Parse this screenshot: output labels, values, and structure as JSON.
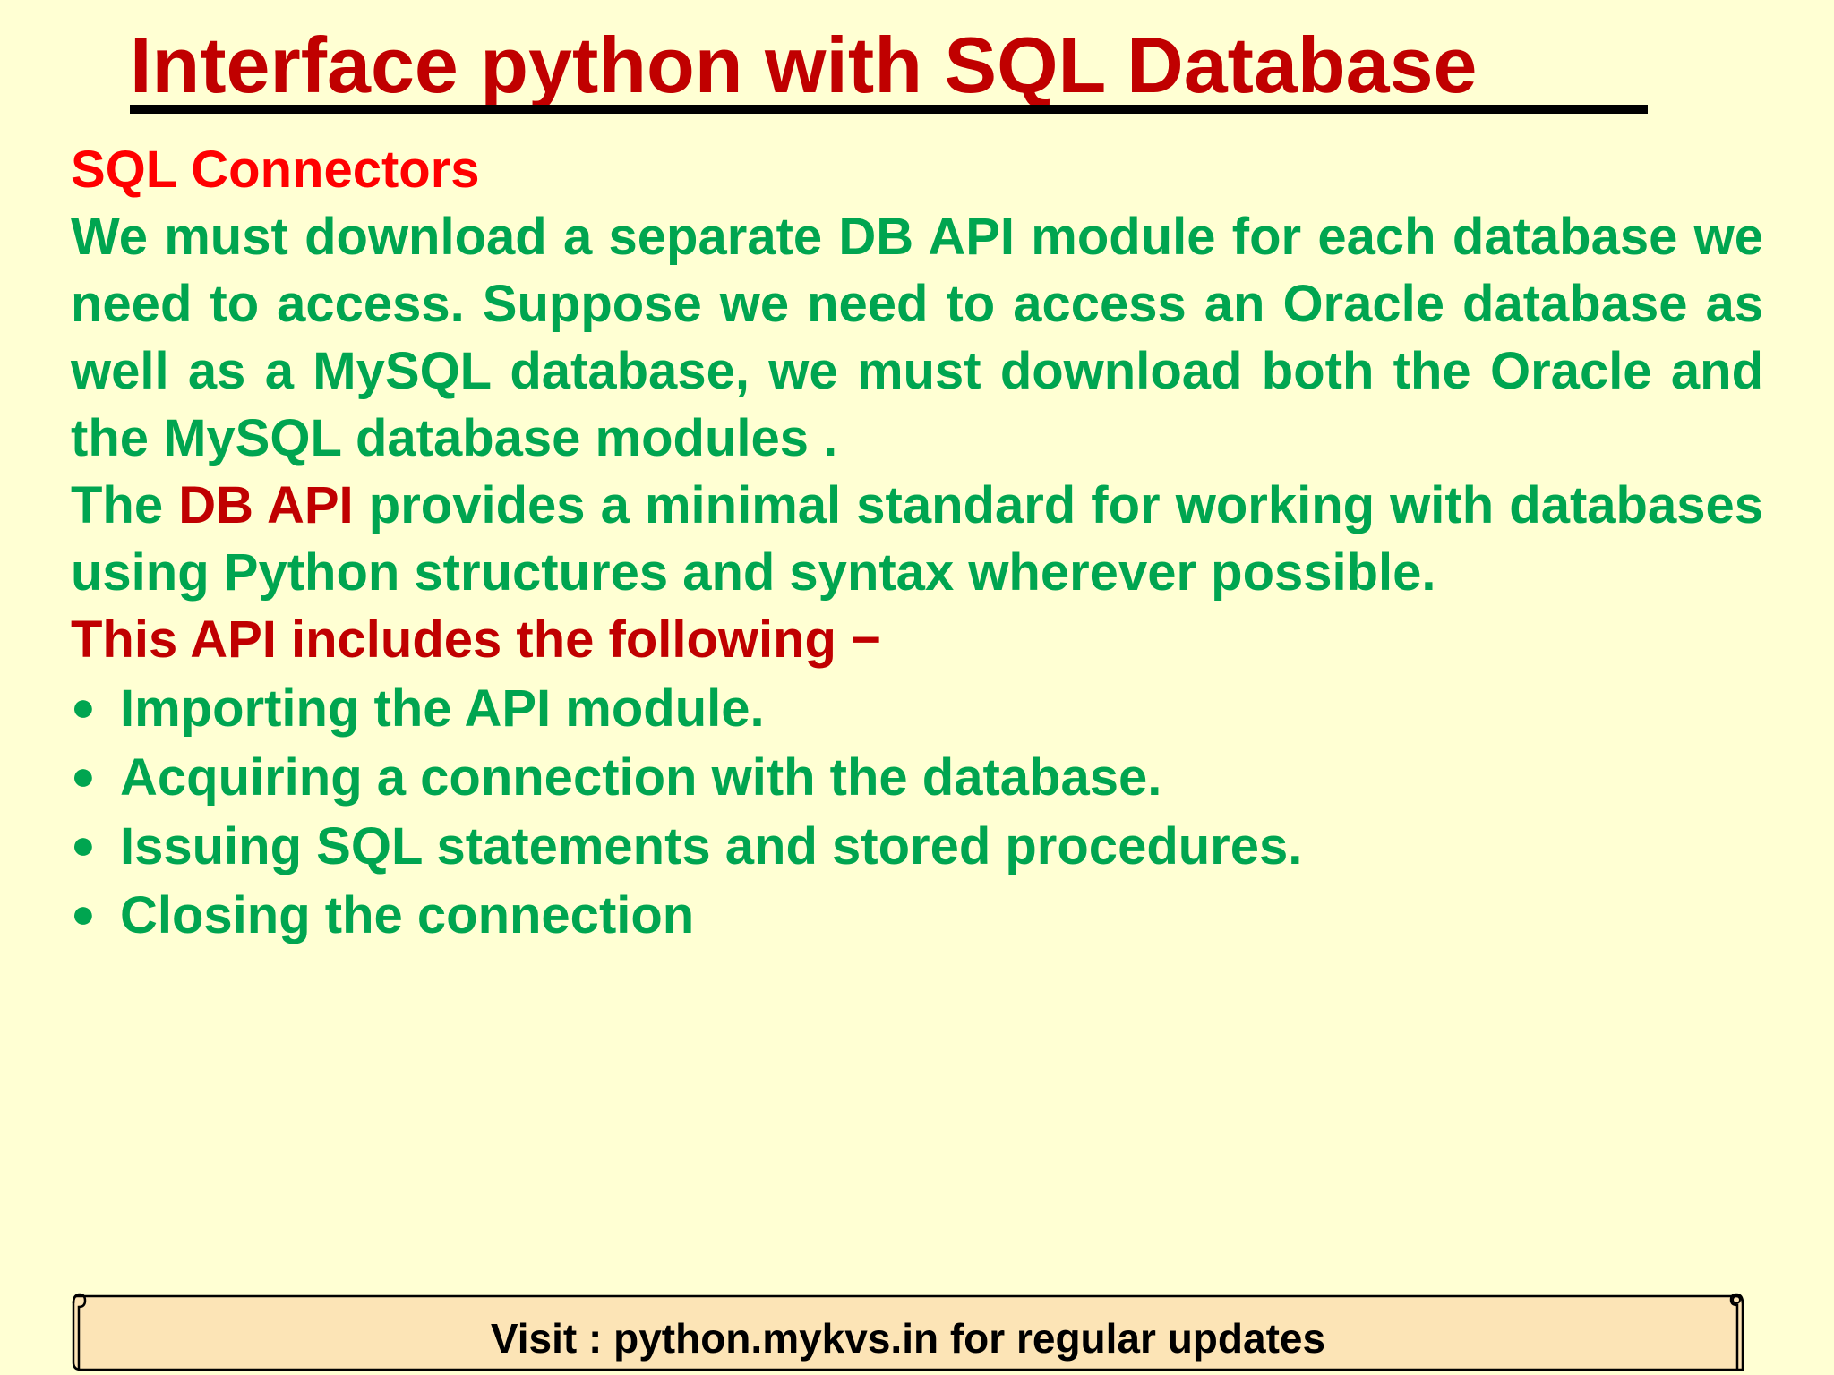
{
  "title": "Interface python with SQL Database",
  "section_heading": "SQL Connectors",
  "paragraph1": "We must download a separate DB API module for each database we need to access. Suppose we need to access an Oracle database as well as a MySQL database, we must download both the Oracle and the MySQL database modules .",
  "paragraph2": {
    "prefix": "The",
    "highlight": "DB API",
    "suffix": "provides a minimal standard for working with databases using Python structures and syntax wherever possible."
  },
  "list_heading": "This API includes the following −",
  "bullet_symbol": "●",
  "bullets": [
    "Importing the API module.",
    "Acquiring a connection with the database.",
    "Issuing SQL statements and stored procedures.",
    "Closing the connection"
  ],
  "footer": "Visit : python.mykvs.in for regular updates",
  "colors": {
    "background": "#ffffd3",
    "title": "#c00000",
    "heading": "#ff0000",
    "body_text": "#00a550",
    "highlight": "#c00000",
    "footer_fill": "#fce4b6"
  }
}
